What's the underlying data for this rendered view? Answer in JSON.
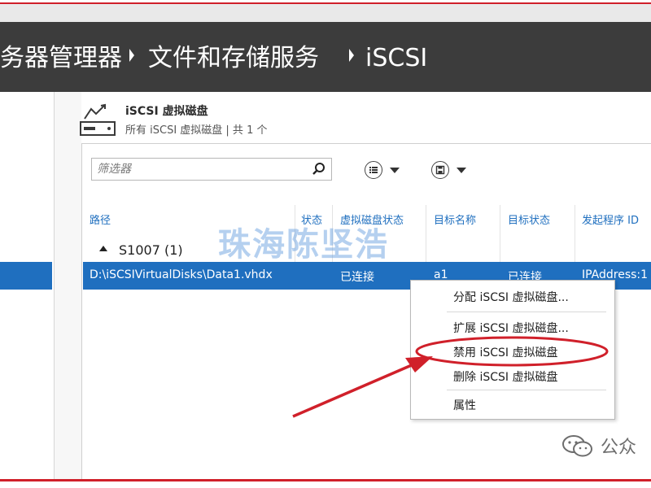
{
  "breadcrumb": {
    "items": [
      "务器管理器",
      "文件和存储服务",
      "iSCSI"
    ]
  },
  "tile": {
    "title": "iSCSI 虚拟磁盘",
    "subtitle": "所有 iSCSI 虚拟磁盘 | 共 1 个"
  },
  "filter": {
    "placeholder": "筛选器"
  },
  "columns": [
    "路径",
    "状态",
    "虚拟磁盘状态",
    "目标名称",
    "目标状态",
    "发起程序 ID"
  ],
  "group": {
    "label": "S1007 (1)"
  },
  "row": {
    "path": "D:\\iSCSIVirtualDisks\\Data1.vhdx",
    "disk_status": "已连接",
    "target_name": "a1",
    "target_status": "已连接",
    "initiator_id": "IPAddress:1"
  },
  "context_menu": {
    "items": [
      "分配 iSCSI 虚拟磁盘...",
      "扩展 iSCSI 虚拟磁盘...",
      "禁用 iSCSI 虚拟磁盘",
      "删除 iSCSI 虚拟磁盘",
      "属性"
    ]
  },
  "watermark": {
    "text": "珠海陈坚浩"
  },
  "wechat": {
    "text": "公众"
  },
  "colors": {
    "header_bg": "#3c3c3c",
    "selection": "#1f6fbf",
    "annotation_red": "#d0202a"
  },
  "icons": [
    "iscsi-disk-icon",
    "search-icon",
    "list-view-icon",
    "save-icon",
    "wechat-icon"
  ]
}
